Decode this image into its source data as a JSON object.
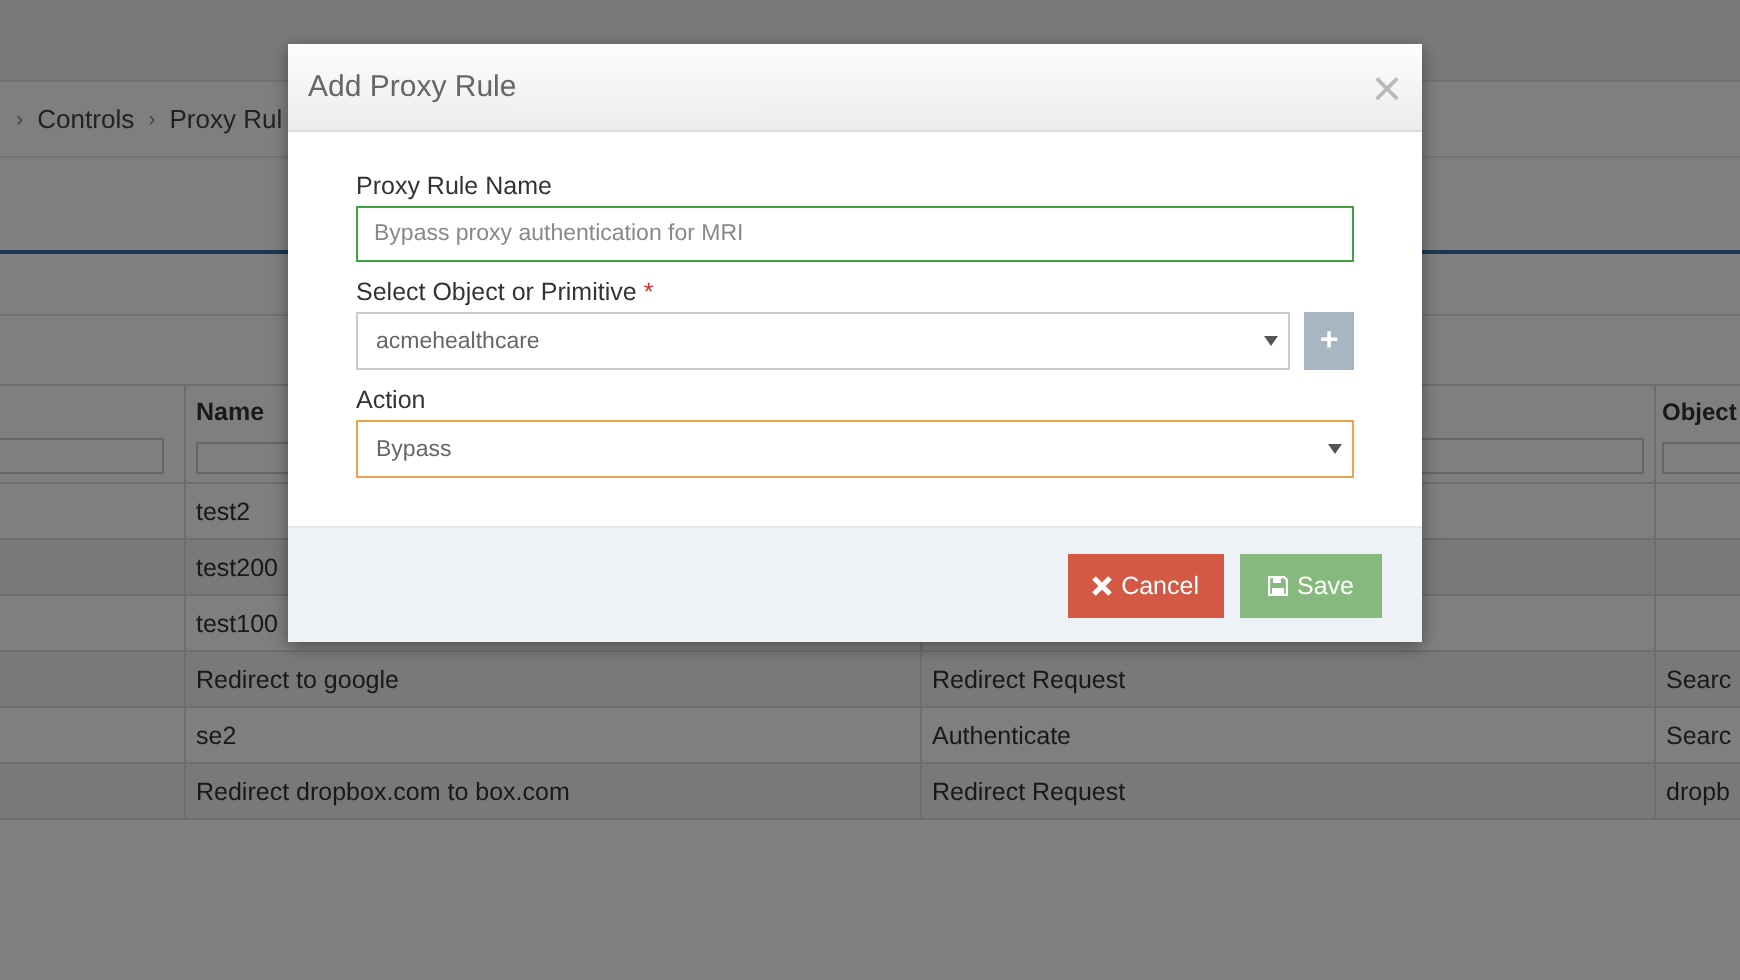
{
  "breadcrumb": {
    "separator": "›",
    "items": [
      "Controls",
      "Proxy Rul"
    ]
  },
  "table": {
    "headers": {
      "name": "Name",
      "column_4": "Object"
    },
    "rows": [
      {
        "name": "test2"
      },
      {
        "name": "test200"
      },
      {
        "name": "test100"
      },
      {
        "name": "Redirect to google",
        "column_3": "Redirect Request",
        "column_4": "Searc"
      },
      {
        "name": "se2",
        "column_3": "Authenticate",
        "column_4": "Searc"
      },
      {
        "name": "Redirect dropbox.com to box.com",
        "column_3": "Redirect Request",
        "column_4": "dropb"
      }
    ]
  },
  "dialog": {
    "title": "Add Proxy Rule",
    "close": "×",
    "fields": [
      {
        "kind": "text",
        "label": "Proxy Rule Name",
        "placeholder": "Bypass proxy authentication for MRI",
        "valid": true,
        "focused": false
      },
      {
        "kind": "select",
        "label": "Select Object or Primitive",
        "required_mark": "*",
        "value": "acmehealthcare",
        "valid": false,
        "focused": false,
        "add_button": "+"
      },
      {
        "kind": "select",
        "label": "Action",
        "value": "Bypass",
        "valid": false,
        "focused": true
      }
    ],
    "buttons": [
      {
        "kind": "cancel",
        "label": "Cancel"
      },
      {
        "kind": "save",
        "label": "Save"
      }
    ]
  }
}
